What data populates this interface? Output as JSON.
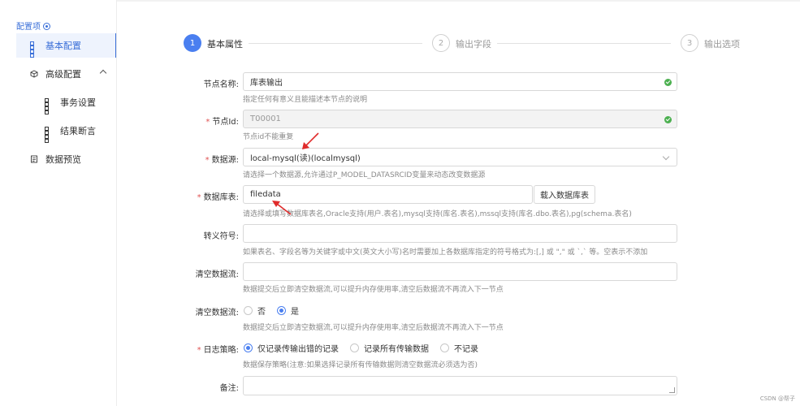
{
  "sidebar": {
    "title": "配置项",
    "items": [
      {
        "label": "基本配置"
      },
      {
        "label": "高级配置"
      },
      {
        "label": "事务设置"
      },
      {
        "label": "结果断言"
      },
      {
        "label": "数据预览"
      }
    ]
  },
  "steps": [
    {
      "number": "1",
      "label": "基本属性",
      "state": "active"
    },
    {
      "number": "2",
      "label": "输出字段",
      "state": "pending"
    },
    {
      "number": "3",
      "label": "输出选项",
      "state": "pending"
    }
  ],
  "form": {
    "node_name": {
      "label": "节点名称:",
      "value": "库表输出",
      "hint": "指定任何有意义且能描述本节点的说明"
    },
    "node_id": {
      "label": "节点Id:",
      "value": "T00001",
      "hint": "节点id不能重复"
    },
    "datasource": {
      "label": "数据源:",
      "value": "local-mysql(读)(localmysql)",
      "hint": "请选择一个数据源,允许通过P_MODEL_DATASRCID变量来动态改变数据源"
    },
    "db_table": {
      "label": "数据库表:",
      "value": "filedata",
      "button": "载入数据库表",
      "hint": "请选择或填写数据库表名,Oracle支持(用户.表名),mysql支持(库名.表名),mssql支持(库名.dbo.表名),pg(schema.表名)"
    },
    "escape": {
      "label": "转义符号:",
      "value": "",
      "hint": "如果表名、字段名等为关键字或中文(英文大小写)名时需要加上各数据库指定的符号格式为:[,] 或 \",\" 或 `,` 等。空表示不添加"
    },
    "clear_flow_text": {
      "label": "清空数据流:",
      "value": "",
      "hint": "数据提交后立即清空数据流,可以提升内存使用率,清空后数据流不再流入下一节点"
    },
    "clear_flow_radio": {
      "label": "清空数据流:",
      "options": [
        "否",
        "是"
      ],
      "selected": "是",
      "hint": "数据提交后立即清空数据流,可以提升内存使用率,清空后数据流不再流入下一节点"
    },
    "log_policy": {
      "label": "日志策略:",
      "options": [
        "仅记录传输出错的记录",
        "记录所有传输数据",
        "不记录"
      ],
      "selected": "仅记录传输出错的记录",
      "hint": "数据保存策略(注意:如果选择记录所有传输数据则清空数据流必须选为否)"
    },
    "remark": {
      "label": "备注:",
      "value": ""
    }
  },
  "watermark": "CSDN @帮子",
  "colors": {
    "accent": "#4a7ff0",
    "required": "#e05353",
    "valid": "#4cb050",
    "annotation_arrow": "#e02b2b"
  }
}
